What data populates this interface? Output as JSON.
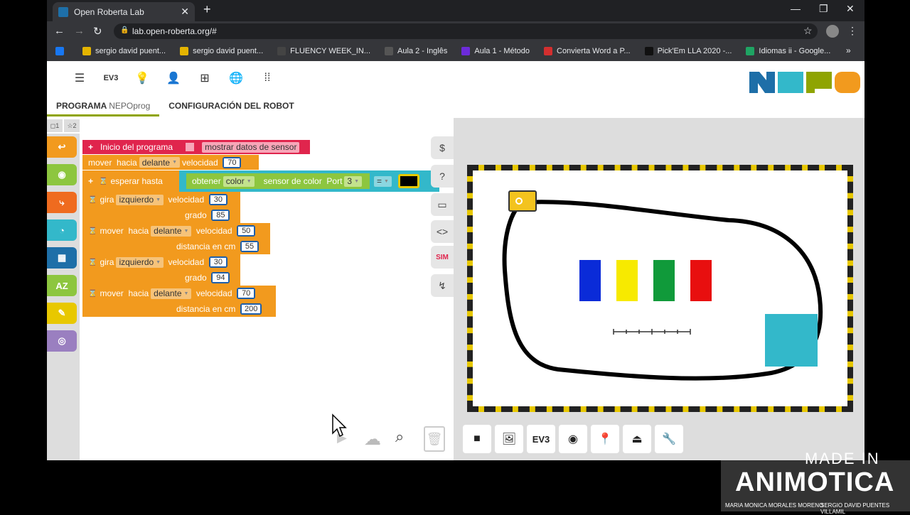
{
  "browser": {
    "tab_title": "Open Roberta Lab",
    "tab_close": "✕",
    "new_tab": "+",
    "minimize": "—",
    "maximize": "❐",
    "close": "✕",
    "back": "←",
    "forward": "→",
    "reload": "↻",
    "url": "lab.open-roberta.org/#",
    "lock": "🔒",
    "star": "☆",
    "menu": "⋮",
    "more": "»",
    "bookmarks": [
      {
        "label": "",
        "color": "#1877f2"
      },
      {
        "label": "sergio david puent...",
        "color": "#e4b400"
      },
      {
        "label": "sergio david puent...",
        "color": "#e4b400"
      },
      {
        "label": "FLUENCY WEEK_IN...",
        "color": "#444"
      },
      {
        "label": "Aula 2 - Inglês",
        "color": "#555"
      },
      {
        "label": "Aula 1 - Método",
        "color": "#6c2bd9"
      },
      {
        "label": "Convierta Word a P...",
        "color": "#d32f2f"
      },
      {
        "label": "Pick'Em LLA 2020 -...",
        "color": "#111"
      },
      {
        "label": "Idiomas ii - Google...",
        "color": "#1fa463"
      }
    ]
  },
  "app": {
    "top_icons": [
      "☰",
      "EV3",
      "💡",
      "👤",
      "⊞",
      "🌐",
      "⁞⁞"
    ],
    "tabs": {
      "program": "PROGRAMA",
      "program_name": "NEPOprog",
      "robot_config": "CONFIGURACIÓN DEL ROBOT"
    },
    "ws_tabs": [
      "◻1",
      "☆2"
    ],
    "toolbox": [
      {
        "icon": "↩",
        "color": "#f29a1e"
      },
      {
        "icon": "◉",
        "color": "#8dc63f"
      },
      {
        "icon": "⤷",
        "color": "#ef6b1f"
      },
      {
        "icon": "◔",
        "color": "#33b8ca"
      },
      {
        "icon": "▦",
        "color": "#1e6fa8"
      },
      {
        "icon": "AZ",
        "color": "#8dc63f"
      },
      {
        "icon": "✎",
        "color": "#e8c800"
      },
      {
        "icon": "◎",
        "color": "#9a7fc0"
      }
    ],
    "side_controls": [
      "$",
      "?",
      "▭",
      "<>",
      "SIM",
      "↯"
    ],
    "bottom_tools": {
      "run": "▶",
      "cloud": "☁",
      "zoom": "⌕",
      "trash": "🗑"
    }
  },
  "blocks": {
    "start": {
      "plus": "+",
      "label": "Inicio del programa",
      "sensor_label": "mostrar datos de sensor"
    },
    "b1": {
      "verb": "mover",
      "dir_word": "hacia",
      "dir": "delante",
      "speed_label": "velocidad",
      "speed": "70"
    },
    "b2": {
      "plus": "+",
      "wait_icon": "⌛",
      "label": "esperar hasta",
      "get": "obtener",
      "mode": "color",
      "sensor": "sensor de color",
      "port_label": "Port",
      "port": "3",
      "op": "="
    },
    "b3": {
      "icon": "⌛",
      "verb": "gira",
      "dir": "izquierdo",
      "speed_label": "velocidad",
      "speed": "30",
      "deg_label": "grado",
      "deg": "85"
    },
    "b4": {
      "icon": "⌛",
      "verb": "mover",
      "dir_word": "hacia",
      "dir": "delante",
      "speed_label": "velocidad",
      "speed": "50",
      "dist_label": "distancia en cm",
      "dist": "55"
    },
    "b5": {
      "icon": "⌛",
      "verb": "gira",
      "dir": "izquierdo",
      "speed_label": "velocidad",
      "speed": "30",
      "deg_label": "grado",
      "deg": "94"
    },
    "b6": {
      "icon": "⌛",
      "verb": "mover",
      "dir_word": "hacia",
      "dir": "delante",
      "speed_label": "velocidad",
      "speed": "70",
      "dist_label": "distancia en cm",
      "dist": "200"
    }
  },
  "sim": {
    "buttons": [
      "■",
      "🖼",
      "EV3",
      "◉",
      "📍",
      "⏏",
      "🔧"
    ],
    "color_blocks": [
      "#0a2bd8",
      "#f7ea00",
      "#109a3a",
      "#e80f0f"
    ],
    "square_color": "#33b8ca"
  },
  "watermark": {
    "made_in": "MADE IN",
    "brand": "ANIMOTICA",
    "name_left": "MARIA MONICA MORALES MORENO",
    "name_right": "SERGIO DAVID PUENTES VILLAMIL"
  }
}
